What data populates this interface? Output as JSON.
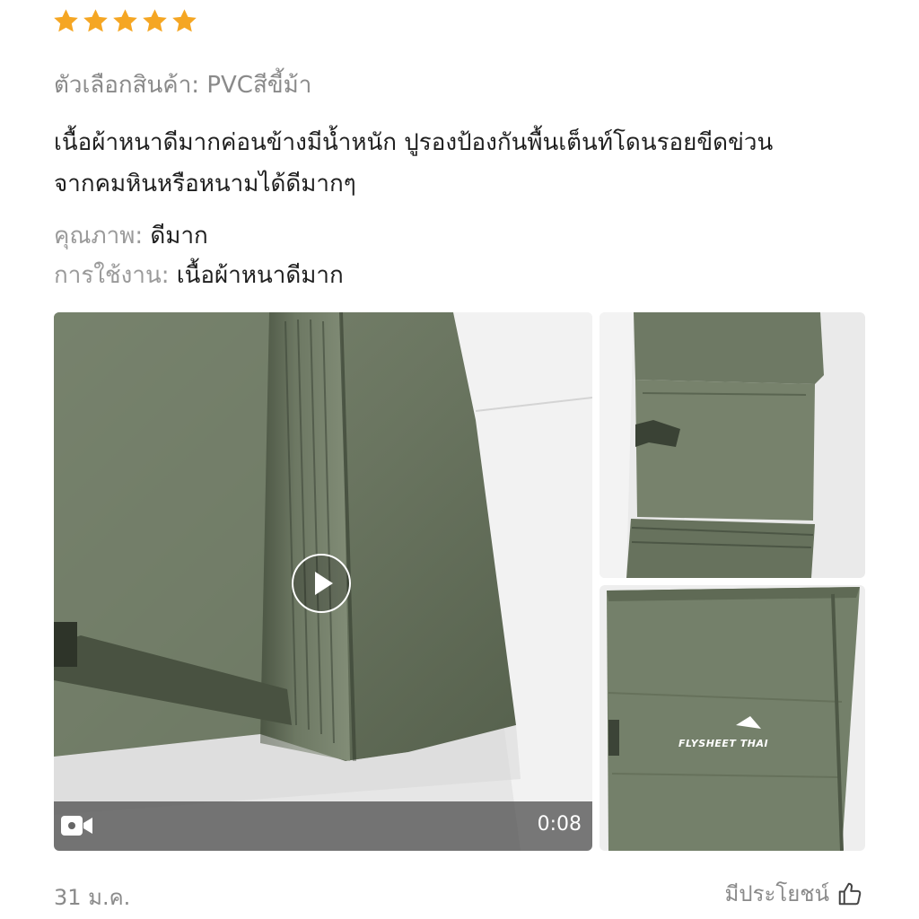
{
  "rating": {
    "stars": 5,
    "max": 5,
    "color": "#f5a623"
  },
  "variant": {
    "label": "ตัวเลือกสินค้า:",
    "value": "PVCสีขี้ม้า"
  },
  "review_text": {
    "line1": "เนื้อผ้าหนาดีมากค่อนข้างมีน้ำหนัก ปูรองป้องกันพื้นเต็นท์โดนรอยขีดข่วน",
    "line2": "จากคมหินหรือหนามได้ดีมากๆ"
  },
  "attributes": {
    "quality": {
      "label": "คุณภาพ:",
      "value": "ดีมาก"
    },
    "usage": {
      "label": "การใช้งาน:",
      "value": "เนื้อผ้าหนาดีมาก"
    }
  },
  "media": {
    "video": {
      "duration": "0:08",
      "icon": "video-camera-icon",
      "play_icon": "play-icon"
    },
    "thumbnail_logo": "FLYSHEET THAI"
  },
  "footer": {
    "date": "31 ม.ค.",
    "helpful_label": "มีประโยชน์",
    "helpful_icon": "thumbs-up-icon"
  }
}
